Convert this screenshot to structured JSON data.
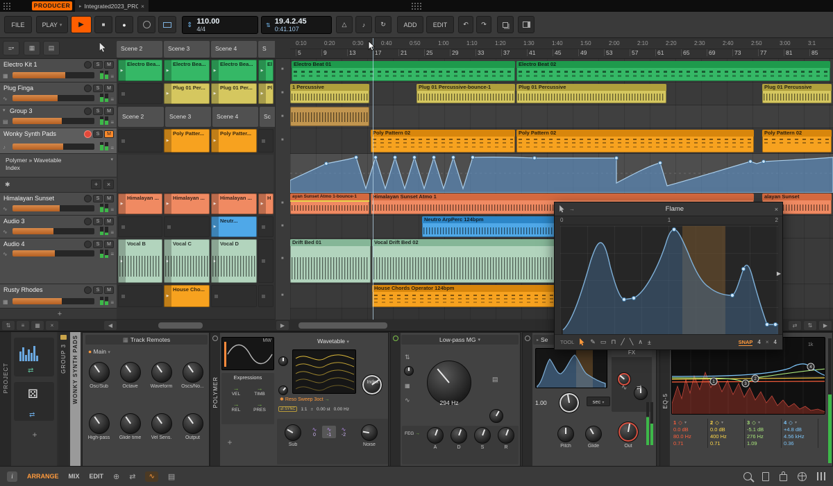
{
  "icons": {
    "play": "▶",
    "stop": "■",
    "record": "●",
    "dropdown": "▾",
    "expander": "▸",
    "menu": "≡",
    "undo": "↶",
    "redo": "↷",
    "loop": "↻",
    "note": "♪",
    "metronome": "△",
    "updown": "⇅",
    "swap": "⇄",
    "arrow": "→",
    "wave": "∿",
    "grid": "▦",
    "bars": "▤",
    "target": "⊕",
    "asterisk": "✱",
    "plusminus": "±",
    "diamond": "◇",
    "pencil": "✎",
    "rect": "▭",
    "step": "⊓",
    "slope_up": "╱",
    "slope_down": "╲",
    "peak": "∧",
    "back": "◀",
    "fwd": "▶",
    "dice": "⚄",
    "vslider": "⇕",
    "info": "i"
  },
  "labels": {
    "solo": "S",
    "mute": "M",
    "add": "+",
    "close": "×"
  },
  "titlebar": {
    "producer": "PRODUCER",
    "tab": "Integrated2023_PRO"
  },
  "transport": {
    "file": "FILE",
    "play_menu": "PLAY",
    "tempo": "110.00",
    "time_sig": "4/4",
    "position": "19.4.2.45",
    "time": "0:41.107",
    "add": "ADD",
    "edit": "EDIT"
  },
  "ruler": {
    "times": [
      "0:10",
      "0:20",
      "0:30",
      "0:40",
      "0:50",
      "1:00",
      "1:10",
      "1:20",
      "1:30",
      "1:40",
      "1:50",
      "2:00",
      "2:10",
      "2:20",
      "2:30",
      "2:40",
      "2:50",
      "3:00",
      "3:1"
    ],
    "bars": [
      "5",
      "9",
      "13",
      "17",
      "21",
      "25",
      "29",
      "33",
      "37",
      "41",
      "45",
      "49",
      "53",
      "57",
      "61",
      "65",
      "69",
      "73",
      "77",
      "81",
      "85"
    ]
  },
  "scene_headers": [
    "Scene 2",
    "Scene 3",
    "Scene 4",
    "S"
  ],
  "group_scene_headers": [
    "Scene 2",
    "Scene 3",
    "Scene 4",
    "Sc"
  ],
  "tracks": [
    {
      "name": "Electro Kit 1"
    },
    {
      "name": "Plug Finga"
    },
    {
      "name": "Group 3"
    },
    {
      "name": "Wonky Synth Pads"
    },
    {
      "name": "Himalayan Sunset"
    },
    {
      "name": "Audio 3"
    },
    {
      "name": "Audio 4"
    },
    {
      "name": "Rusty Rhodes"
    }
  ],
  "automation_lane": {
    "line1": "Polymer » Wavetable",
    "line2": "Index"
  },
  "launcher": {
    "electro": [
      "Electro Bea...",
      "Electro Bea...",
      "Electro Bea...",
      "El"
    ],
    "plug": [
      "Plug 01 Per...",
      "Plug 01 Per...",
      "Pl"
    ],
    "poly": [
      "Poly Patter...",
      "Poly Patter..."
    ],
    "himalayan": [
      "Himalayan ...",
      "Himalayan ...",
      "Himalayan ...",
      "H"
    ],
    "neutro": "Neutr...",
    "vocal": [
      "Vocal B",
      "Vocal C",
      "Vocal D"
    ],
    "house": "House Cho..."
  },
  "arranger": {
    "electro_beat_01": "Electro Beat 01",
    "electro_beat_02": "Electro Beat 02",
    "percussive_left": "1 Percussive",
    "plug_bounce": "Plug 01 Percussive-bounce-1",
    "plug_percussive": "Plug 01 Percussive",
    "plug_percussive_right": "Plug 01 Percussive",
    "poly_pattern_1": "Poly Pattern 02",
    "poly_pattern_2": "Poly Pattern 02",
    "poly_pattern_right": "Poly Pattern 02",
    "sunset_bounce": "ayan Sunset Atmo 1-bounce-1",
    "sunset_atmo": "Himalayan Sunset Atmo 1",
    "sunset_right": "alayan Sunset",
    "neutro_arp": "Neutro ArpPerc 124bpm",
    "drift_bed": "Drift Bed 01",
    "vocal_drift": "Vocal Drift Bed 02",
    "house_chords": "House Chords Operator 124bpm"
  },
  "flame": {
    "title": "Flame",
    "ruler": [
      "0",
      "1",
      "2"
    ],
    "tool": "TOOL",
    "snap": "SNAP",
    "snap_x": "4",
    "snap_mult": "×",
    "snap_y": "4"
  },
  "panels": {
    "project": "PROJECT",
    "group_tab": "GROUP 3",
    "track_tab": "WONKY SYNTH PADS"
  },
  "remotes": {
    "title": "Track Remotes",
    "page": "Main",
    "knobs": [
      "Osc/Sub",
      "Octave",
      "Waveform",
      "Oscs/No...",
      "High-pass",
      "Glide time",
      "Vel Sens.",
      "Output"
    ]
  },
  "polymer": {
    "name": "POLYMER",
    "mw": "MW",
    "expressions_title": "Expressions",
    "expressions": [
      "VEL",
      "TIMB",
      "REL",
      "PRES"
    ],
    "menu": "Wavetable",
    "preset": "Reso Sweep 3oct",
    "index": "Index",
    "sync": "SYNC",
    "ratio": "1:1",
    "detune_st": "0.00 st",
    "detune_hz": "0.00 Hz",
    "sub": "Sub",
    "octaves": [
      "0",
      "-1",
      "-2"
    ],
    "noise": "Noise"
  },
  "lowpass": {
    "title": "Low-pass MG",
    "cutoff": "294 Hz",
    "feg": "FEG",
    "adsr": [
      "A",
      "D",
      "S",
      "R"
    ]
  },
  "chain": {
    "header": "Se",
    "value": "1.00",
    "unit": "sec",
    "fx": "FX",
    "pitch": "Pitch",
    "glide": "Glide",
    "out": "Out"
  },
  "eq": {
    "name": "EQ-5",
    "freq_ref": "1k",
    "bands": [
      {
        "num": "1",
        "gain": "0.0 dB",
        "freq": "80.0 Hz",
        "q": "0.71",
        "color": "#ff5f3c"
      },
      {
        "num": "2",
        "gain": "0.0 dB",
        "freq": "400 Hz",
        "q": "0.71",
        "color": "#ffd848"
      },
      {
        "num": "3",
        "gain": "-5.1 dB",
        "freq": "276 Hz",
        "q": "1.09",
        "color": "#a8e47a"
      },
      {
        "num": "4",
        "gain": "+4.8 dB",
        "freq": "4.56 kHz",
        "q": "0.36",
        "color": "#7cc4f8"
      }
    ]
  },
  "statusbar": {
    "arrange": "ARRANGE",
    "mix": "MIX",
    "edit": "EDIT"
  }
}
